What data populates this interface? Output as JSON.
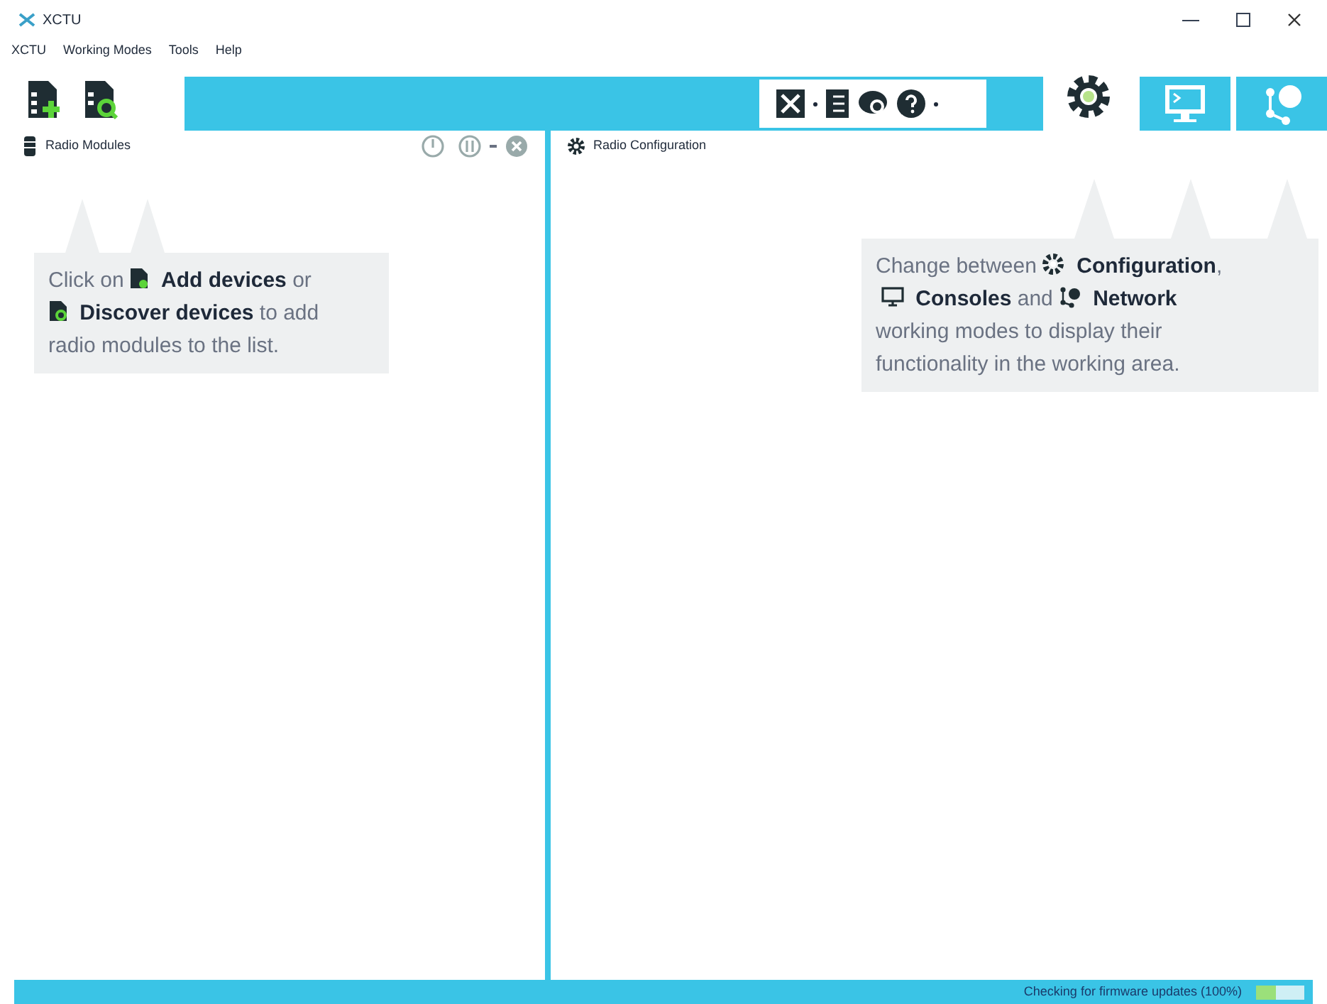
{
  "window": {
    "title": "XCTU"
  },
  "menu": [
    "XCTU",
    "Working Modes",
    "Tools",
    "Help"
  ],
  "modes": [
    {
      "selected": true
    },
    {
      "selected": false
    },
    {
      "selected": false
    }
  ],
  "left_panel": {
    "title": "Radio Modules",
    "hint": [
      {
        "kind": "text",
        "text": "Click on"
      },
      {
        "kind": "icon"
      },
      {
        "kind": "text",
        "text": "**Add devices** or"
      },
      {
        "kind": "break"
      },
      {
        "kind": "icon"
      },
      {
        "kind": "text",
        "text": "**Discover devices** to add"
      },
      {
        "kind": "break"
      },
      {
        "kind": "text",
        "text": "radio modules to the list."
      }
    ]
  },
  "right_panel": {
    "title": "Radio Configuration",
    "hint": [
      {
        "kind": "text",
        "text": "Change between"
      },
      {
        "kind": "icon"
      },
      {
        "kind": "text",
        "text": "**Configuration**,"
      },
      {
        "kind": "break"
      },
      {
        "kind": "icon"
      },
      {
        "kind": "text",
        "text": "**Consoles** and"
      },
      {
        "kind": "icon"
      },
      {
        "kind": "text",
        "text": "**Network**"
      },
      {
        "kind": "break"
      },
      {
        "kind": "text",
        "text": "working modes to display their"
      },
      {
        "kind": "break"
      },
      {
        "kind": "text",
        "text": "functionality in the working area."
      }
    ]
  },
  "status_bar": {
    "text": "Checking for firmware updates (100%)",
    "level": 0.4
  }
}
